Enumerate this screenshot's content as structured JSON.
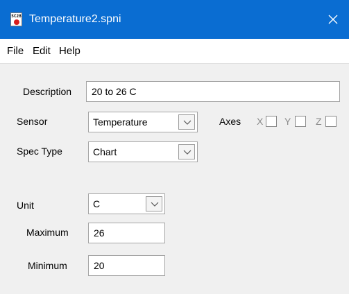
{
  "window": {
    "title": "Temperature2.spni",
    "app_icon_text": "SC28",
    "titlebar_color": "#0a6dd2"
  },
  "menu": {
    "items": [
      "File",
      "Edit",
      "Help"
    ]
  },
  "form": {
    "description": {
      "label": "Description",
      "value": "20 to 26 C"
    },
    "sensor": {
      "label": "Sensor",
      "value": "Temperature"
    },
    "axes": {
      "label": "Axes",
      "items": [
        {
          "label": "X",
          "checked": false
        },
        {
          "label": "Y",
          "checked": false
        },
        {
          "label": "Z",
          "checked": false
        }
      ]
    },
    "spec_type": {
      "label": "Spec Type",
      "value": "Chart"
    },
    "unit": {
      "label": "Unit",
      "value": "C"
    },
    "maximum": {
      "label": "Maximum",
      "value": "26"
    },
    "minimum": {
      "label": "Minimum",
      "value": "20"
    }
  },
  "icons": {
    "close": "close-icon",
    "dropdown": "chevron-down-icon",
    "app": "app-icon"
  }
}
